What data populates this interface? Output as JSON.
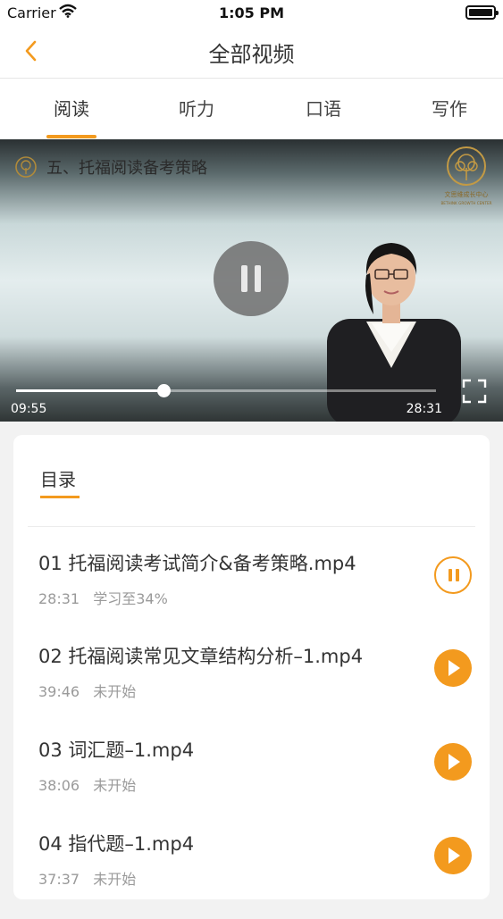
{
  "status_bar": {
    "carrier": "Carrier",
    "time": "1:05 PM"
  },
  "nav": {
    "title": "全部视频",
    "back_icon": "chevron-left-icon"
  },
  "tabs": [
    {
      "label": "阅读",
      "active": true
    },
    {
      "label": "听力",
      "active": false
    },
    {
      "label": "口语",
      "active": false
    },
    {
      "label": "写作",
      "active": false
    }
  ],
  "video": {
    "title": "五、托福阅读备考策略",
    "brand_text": "文思维成长中心",
    "brand_subtext": "BETHINK GROWTH CENTER",
    "current_time": "09:55",
    "total_time": "28:31",
    "progress": 0.35,
    "state": "playing"
  },
  "playlist": {
    "heading": "目录",
    "items": [
      {
        "title": "01 托福阅读考试简介&备考策略.mp4",
        "duration": "28:31",
        "status": "学习至34%",
        "state": "playing"
      },
      {
        "title": "02 托福阅读常见文章结构分析–1.mp4",
        "duration": "39:46",
        "status": "未开始",
        "state": "idle"
      },
      {
        "title": "03 词汇题–1.mp4",
        "duration": "38:06",
        "status": "未开始",
        "state": "idle"
      },
      {
        "title": "04 指代题–1.mp4",
        "duration": "37:37",
        "status": "未开始",
        "state": "idle"
      }
    ]
  },
  "colors": {
    "accent": "#f39a1e",
    "text": "#333333",
    "meta": "#9a9a9a",
    "background": "#f2f2f2"
  }
}
